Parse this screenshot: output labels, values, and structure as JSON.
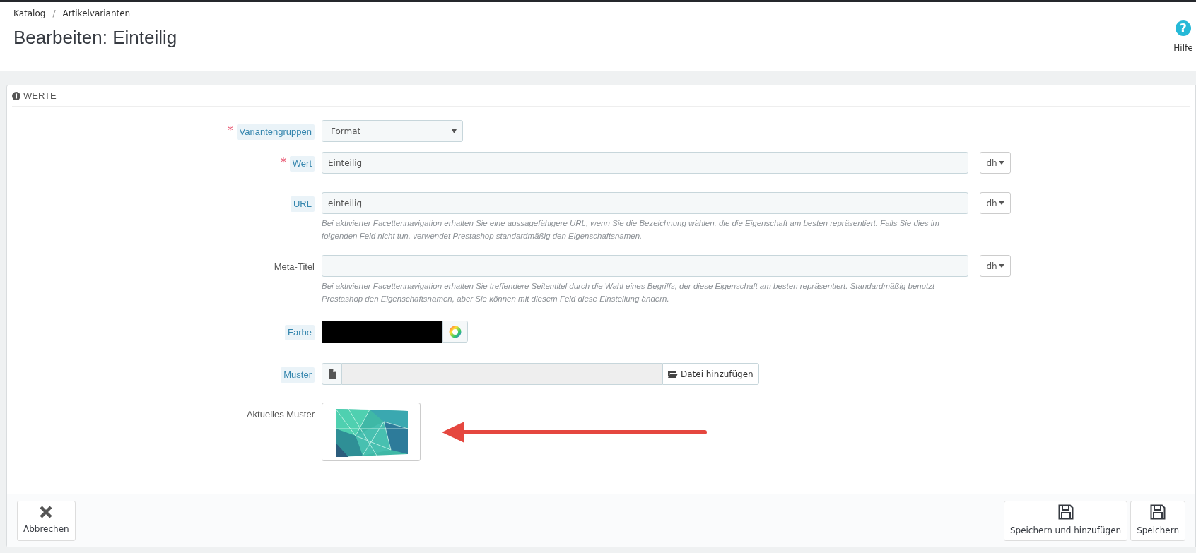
{
  "breadcrumb": {
    "items": [
      "Katalog",
      "Artikelvarianten"
    ],
    "separator": "/"
  },
  "title": "Bearbeiten: Einteilig",
  "help_button": {
    "label": "Hilfe",
    "icon": "?"
  },
  "panel": {
    "title": "WERTE",
    "fields": [
      {
        "kind": "select",
        "label": "Variantengruppen",
        "required_mark": "*",
        "tooltip": true,
        "value": "Format"
      },
      {
        "kind": "text",
        "label": "Wert",
        "required_mark": "*",
        "tooltip": true,
        "value": "Einteilig",
        "language": "dh"
      },
      {
        "kind": "text",
        "label": "URL",
        "tooltip": true,
        "value": "einteilig",
        "language": "dh",
        "help": "Bei aktivierter Facettennavigation erhalten Sie eine aussagefähigere URL, wenn Sie die Bezeichnung wählen, die die Eigenschaft am besten repräsentiert. Falls Sie dies im folgenden Feld nicht tun, verwendet Prestashop standardmäßig den Eigenschaftsnamen."
      },
      {
        "kind": "text",
        "label": "Meta-Titel",
        "tooltip": false,
        "language": "dh",
        "help": "Bei aktivierter Facettennavigation erhalten Sie treffendere Seitentitel durch die Wahl eines Begriffs, der diese Eigenschaft am besten repräsentiert. Standardmäßig benutzt Prestashop den Eigenschaftsnamen, aber Sie können mit diesem Feld diese Einstellung ändern."
      },
      {
        "kind": "color",
        "label": "Farbe",
        "tooltip": true,
        "color": "#000000"
      },
      {
        "kind": "file",
        "label": "Muster",
        "tooltip": true,
        "button": "Datei hinzufügen"
      },
      {
        "label": "Aktuelles Muster",
        "tooltip": false
      }
    ]
  },
  "footer": {
    "buttons": [
      {
        "kind": "cancel",
        "label": "Abbrechen"
      },
      {
        "kind": "save",
        "label": "Speichern und hinzufügen"
      },
      {
        "kind": "save",
        "label": "Speichern"
      }
    ]
  }
}
